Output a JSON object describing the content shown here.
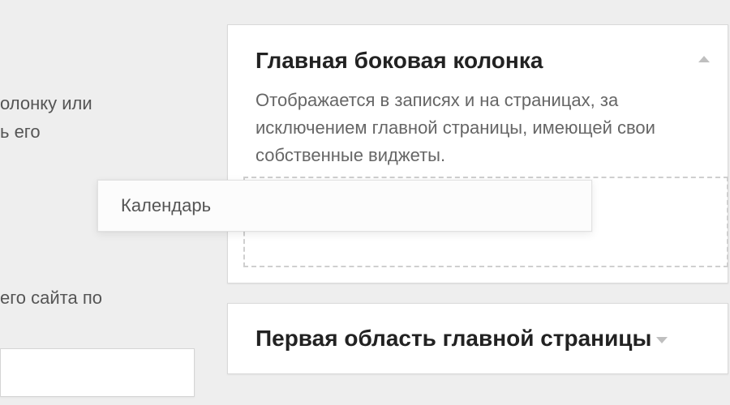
{
  "left": {
    "fragment1_line1": "олонку или",
    "fragment1_line2": "ь его",
    "fragment2": "его сайта по"
  },
  "mainPanel": {
    "title": "Главная боковая колонка",
    "description": "Отображается в записях и на страницах, за исключением главной страницы, имеющей свои собственные виджеты."
  },
  "secondaryPanel": {
    "title": "Первая область главной страницы"
  },
  "draggedWidget": {
    "label": "Календарь"
  }
}
